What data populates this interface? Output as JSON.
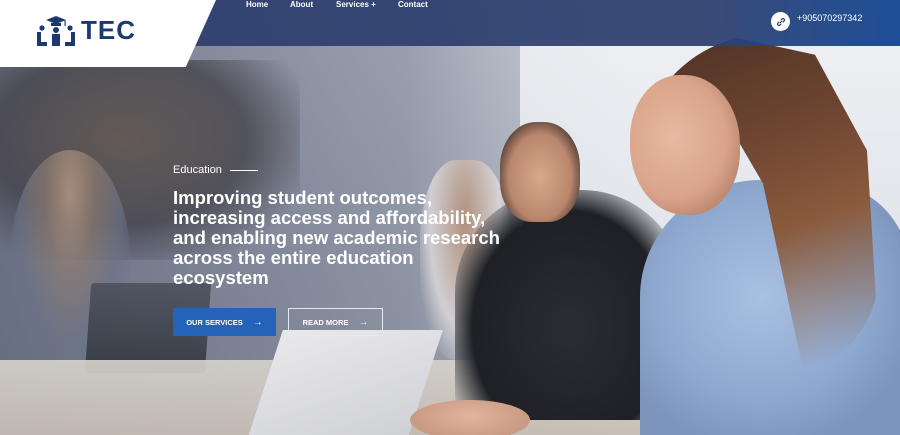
{
  "header": {
    "logo_text": "TEC",
    "logo_icon": "graduation-people-icon",
    "nav": [
      {
        "label": "Home"
      },
      {
        "label": "About"
      },
      {
        "label": "Services +"
      },
      {
        "label": "Contact"
      }
    ],
    "phone_icon": "link-icon",
    "phone": "+905070297342"
  },
  "hero": {
    "eyebrow": "Education",
    "headline": "Improving student outcomes, increasing access and affordability, and enabling new academic research across the entire education ecosystem",
    "buttons": {
      "primary": {
        "label": "OUR SERVICES",
        "icon": "arrow-right-icon",
        "arrow": "→"
      },
      "secondary": {
        "label": "READ MORE",
        "icon": "arrow-right-icon",
        "arrow": "→"
      }
    }
  },
  "colors": {
    "header_bg": "#2d3e6e",
    "brand_dark": "#1d3a70",
    "primary_button": "#2563b8",
    "text_light": "#ffffff"
  }
}
